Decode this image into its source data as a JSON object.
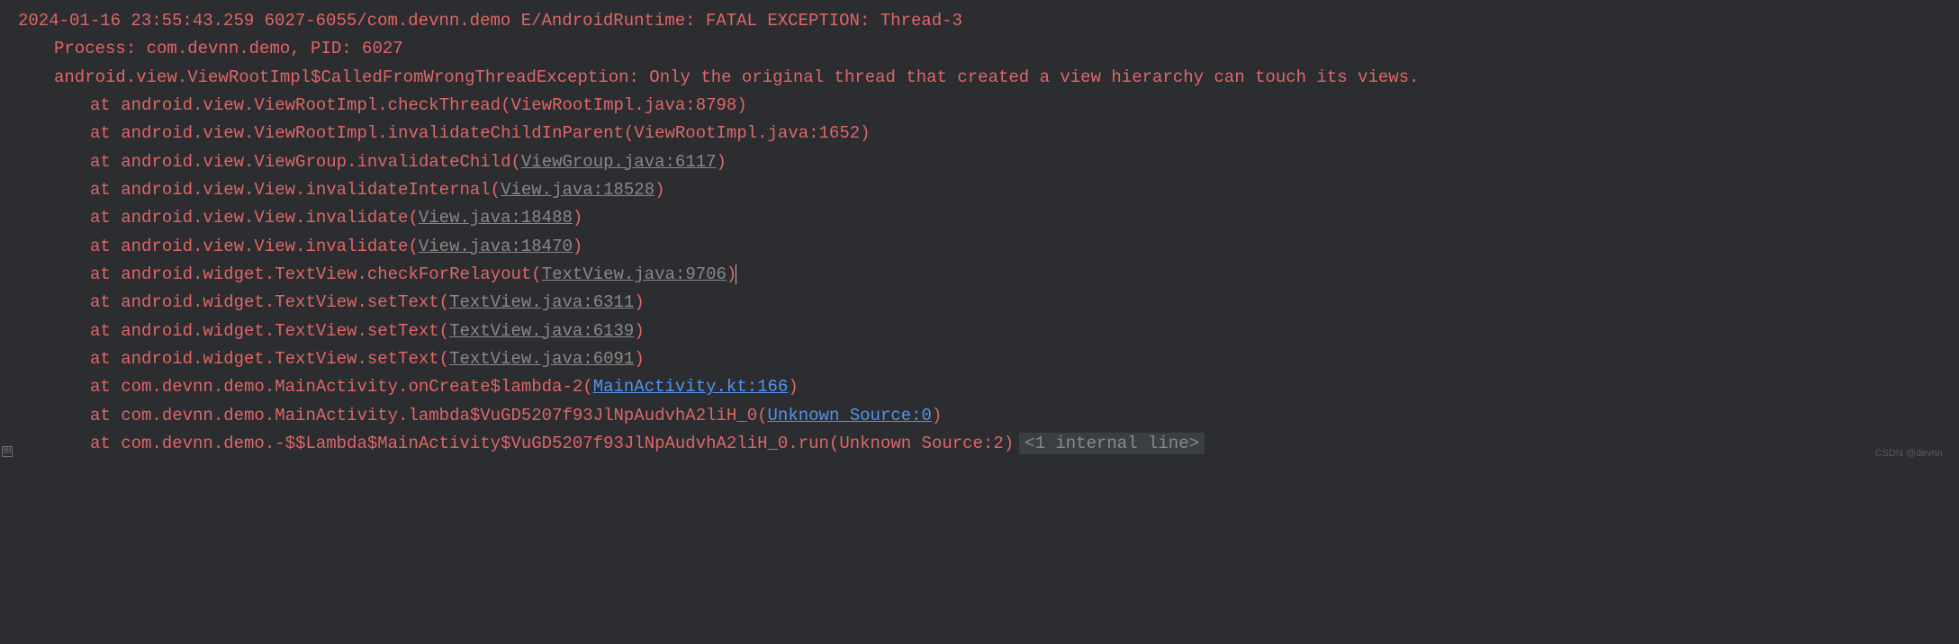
{
  "header": "2024-01-16 23:55:43.259 6027-6055/com.devnn.demo E/AndroidRuntime: FATAL EXCEPTION: Thread-3",
  "process": "Process: com.devnn.demo, PID: 6027",
  "exception": "android.view.ViewRootImpl$CalledFromWrongThreadException: Only the original thread that created a view hierarchy can touch its views.",
  "stack": [
    {
      "prefix": "at android.view.ViewRootImpl.checkThread(ViewRootImpl.java:8798)",
      "link": null,
      "link_type": null,
      "suffix": null,
      "cursor": false
    },
    {
      "prefix": "at android.view.ViewRootImpl.invalidateChildInParent(ViewRootImpl.java:1652)",
      "link": null,
      "link_type": null,
      "suffix": null,
      "cursor": false
    },
    {
      "prefix": "at android.view.ViewGroup.invalidateChild(",
      "link": "ViewGroup.java:6117",
      "link_type": "gray",
      "suffix": ")",
      "cursor": false
    },
    {
      "prefix": "at android.view.View.invalidateInternal(",
      "link": "View.java:18528",
      "link_type": "gray",
      "suffix": ")",
      "cursor": false
    },
    {
      "prefix": "at android.view.View.invalidate(",
      "link": "View.java:18488",
      "link_type": "gray",
      "suffix": ")",
      "cursor": false
    },
    {
      "prefix": "at android.view.View.invalidate(",
      "link": "View.java:18470",
      "link_type": "gray",
      "suffix": ")",
      "cursor": false
    },
    {
      "prefix": "at android.widget.TextView.checkForRelayout(",
      "link": "TextView.java:9706",
      "link_type": "gray",
      "suffix": ")",
      "cursor": true
    },
    {
      "prefix": "at android.widget.TextView.setText(",
      "link": "TextView.java:6311",
      "link_type": "gray",
      "suffix": ")",
      "cursor": false
    },
    {
      "prefix": "at android.widget.TextView.setText(",
      "link": "TextView.java:6139",
      "link_type": "gray",
      "suffix": ")",
      "cursor": false
    },
    {
      "prefix": "at android.widget.TextView.setText(",
      "link": "TextView.java:6091",
      "link_type": "gray",
      "suffix": ")",
      "cursor": false
    },
    {
      "prefix": "at com.devnn.demo.MainActivity.onCreate$lambda-2(",
      "link": "MainActivity.kt:166",
      "link_type": "blue",
      "suffix": ")",
      "cursor": false
    },
    {
      "prefix": "at com.devnn.demo.MainActivity.lambda$VuGD5207f93JlNpAudvhA2liH_0(",
      "link": "Unknown Source:0",
      "link_type": "blue",
      "suffix": ")",
      "cursor": false
    },
    {
      "prefix": "at com.devnn.demo.-$$Lambda$MainActivity$VuGD5207f93JlNpAudvhA2liH_0.run(Unknown Source:2)",
      "link": null,
      "link_type": null,
      "suffix": null,
      "cursor": false,
      "internal": "<1 internal line>"
    }
  ],
  "watermark": "CSDN @devnn",
  "expand_icon": "⊞"
}
